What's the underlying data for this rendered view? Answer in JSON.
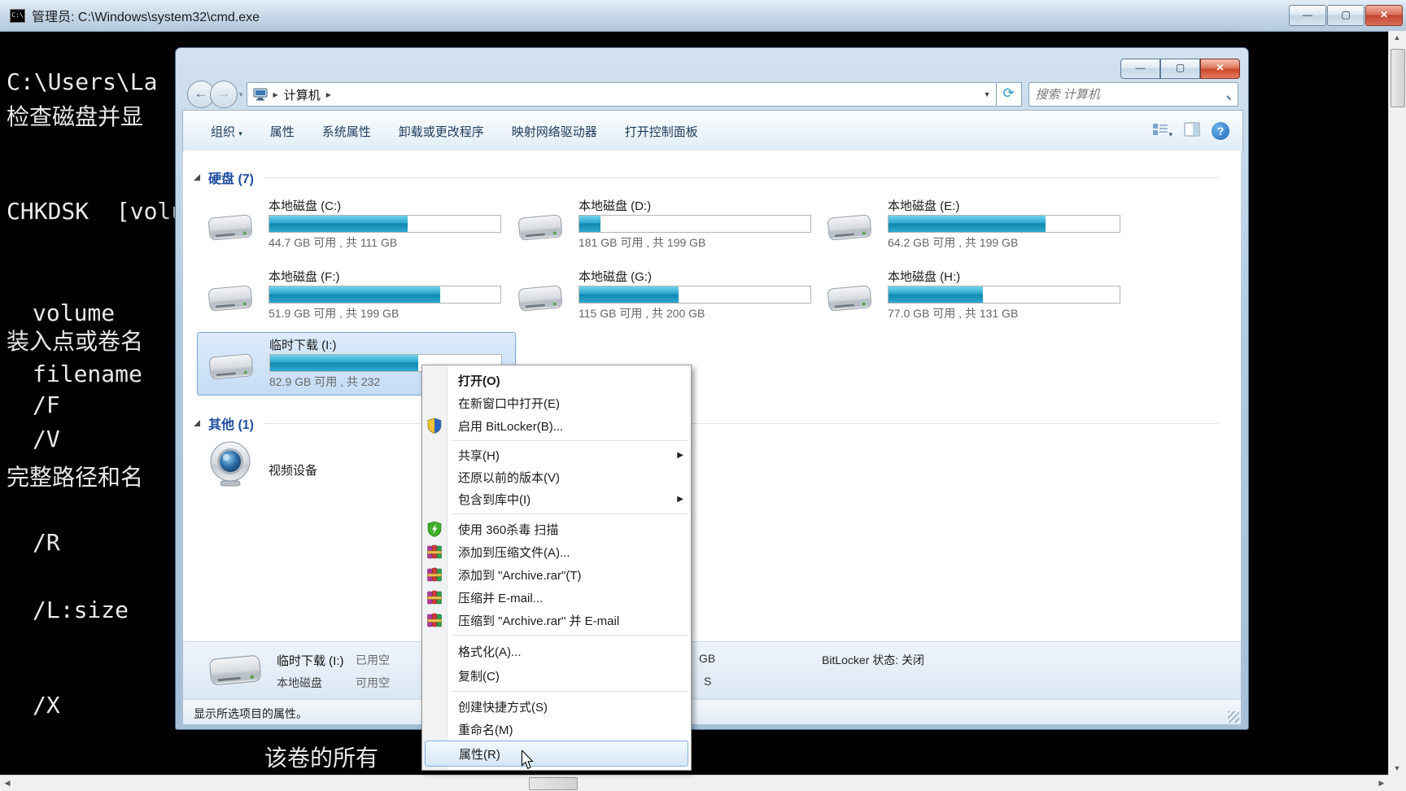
{
  "glyphs": {
    "minimize": "—",
    "maximize": "▢",
    "close": "✕",
    "back": "←",
    "forward": "→",
    "dropdown_small": "▾",
    "breadcrumb_arrow": "▶",
    "address_dropdown": "▼",
    "refresh": "⟳",
    "help": "?",
    "submenu_arrow": "▶",
    "scroll_up": "▲",
    "scroll_down": "▼",
    "scroll_left": "◀",
    "scroll_right": "▶"
  },
  "colors": {
    "accent_teal_bar": "#1e9cc4",
    "selection_blue": "#c5dcf5",
    "group_header_blue": "#1d4e9e",
    "close_red": "#cf4a2c"
  },
  "cmd_window": {
    "title": "管理员: C:\\Windows\\system32\\cmd.exe",
    "icon": "cmd-icon",
    "console_lines": [
      "C:\\Users\\La",
      "检查磁盘并显",
      "CHKDSK  [volu",
      "volume",
      "装入点或卷名",
      "filename",
      "/F",
      "/V",
      "完整路径和名",
      "/R",
      "/L:size",
      "/X",
      "该卷的所有"
    ]
  },
  "explorer": {
    "breadcrumb": {
      "location": "计算机"
    },
    "search_placeholder": "搜索 计算机",
    "toolbar": {
      "organize": "组织",
      "items": [
        "属性",
        "系统属性",
        "卸载或更改程序",
        "映射网络驱动器",
        "打开控制面板"
      ]
    },
    "groups": {
      "hard_disks": "硬盘 (7)",
      "other": "其他 (1)"
    },
    "drives": [
      {
        "name": "本地磁盘 (C:)",
        "caption": "44.7 GB 可用 , 共 111 GB",
        "used_percent": 60
      },
      {
        "name": "本地磁盘 (D:)",
        "caption": "181 GB 可用 , 共 199 GB",
        "used_percent": 9
      },
      {
        "name": "本地磁盘 (E:)",
        "caption": "64.2 GB 可用 , 共 199 GB",
        "used_percent": 68
      },
      {
        "name": "本地磁盘 (F:)",
        "caption": "51.9 GB 可用 , 共 199 GB",
        "used_percent": 74
      },
      {
        "name": "本地磁盘 (G:)",
        "caption": "115 GB 可用 , 共 200 GB",
        "used_percent": 43
      },
      {
        "name": "本地磁盘 (H:)",
        "caption": "77.0 GB 可用 , 共 131 GB",
        "used_percent": 41
      },
      {
        "name": "临时下载 (I:)",
        "caption": "82.9 GB 可用 , 共 232",
        "used_percent": 64
      }
    ],
    "other_items": [
      {
        "name": "视频设备"
      }
    ],
    "details_pane": {
      "item_name": "临时下载 (I:)",
      "item_type": "本地磁盘",
      "used_label_fragment": "已用空",
      "free_label_fragment": "可用空",
      "unit_fragment": "GB",
      "fs_fragment": "S",
      "bitlocker_status": "BitLocker 状态: 关闭"
    },
    "status_bar": "显示所选项目的属性。"
  },
  "context_menu": {
    "items": [
      {
        "label": "打开(O)"
      },
      {
        "label": "在新窗口中打开(E)"
      },
      {
        "label": "启用 BitLocker(B)..."
      },
      {
        "label": "共享(H)"
      },
      {
        "label": "还原以前的版本(V)"
      },
      {
        "label": "包含到库中(I)"
      },
      {
        "label": "使用 360杀毒 扫描"
      },
      {
        "label": "添加到压缩文件(A)..."
      },
      {
        "label": "添加到 \"Archive.rar\"(T)"
      },
      {
        "label": "压缩并 E-mail..."
      },
      {
        "label": "压缩到 \"Archive.rar\" 并 E-mail"
      },
      {
        "label": "格式化(A)..."
      },
      {
        "label": "复制(C)"
      },
      {
        "label": "创建快捷方式(S)"
      },
      {
        "label": "重命名(M)"
      },
      {
        "label": "属性(R)"
      }
    ]
  }
}
